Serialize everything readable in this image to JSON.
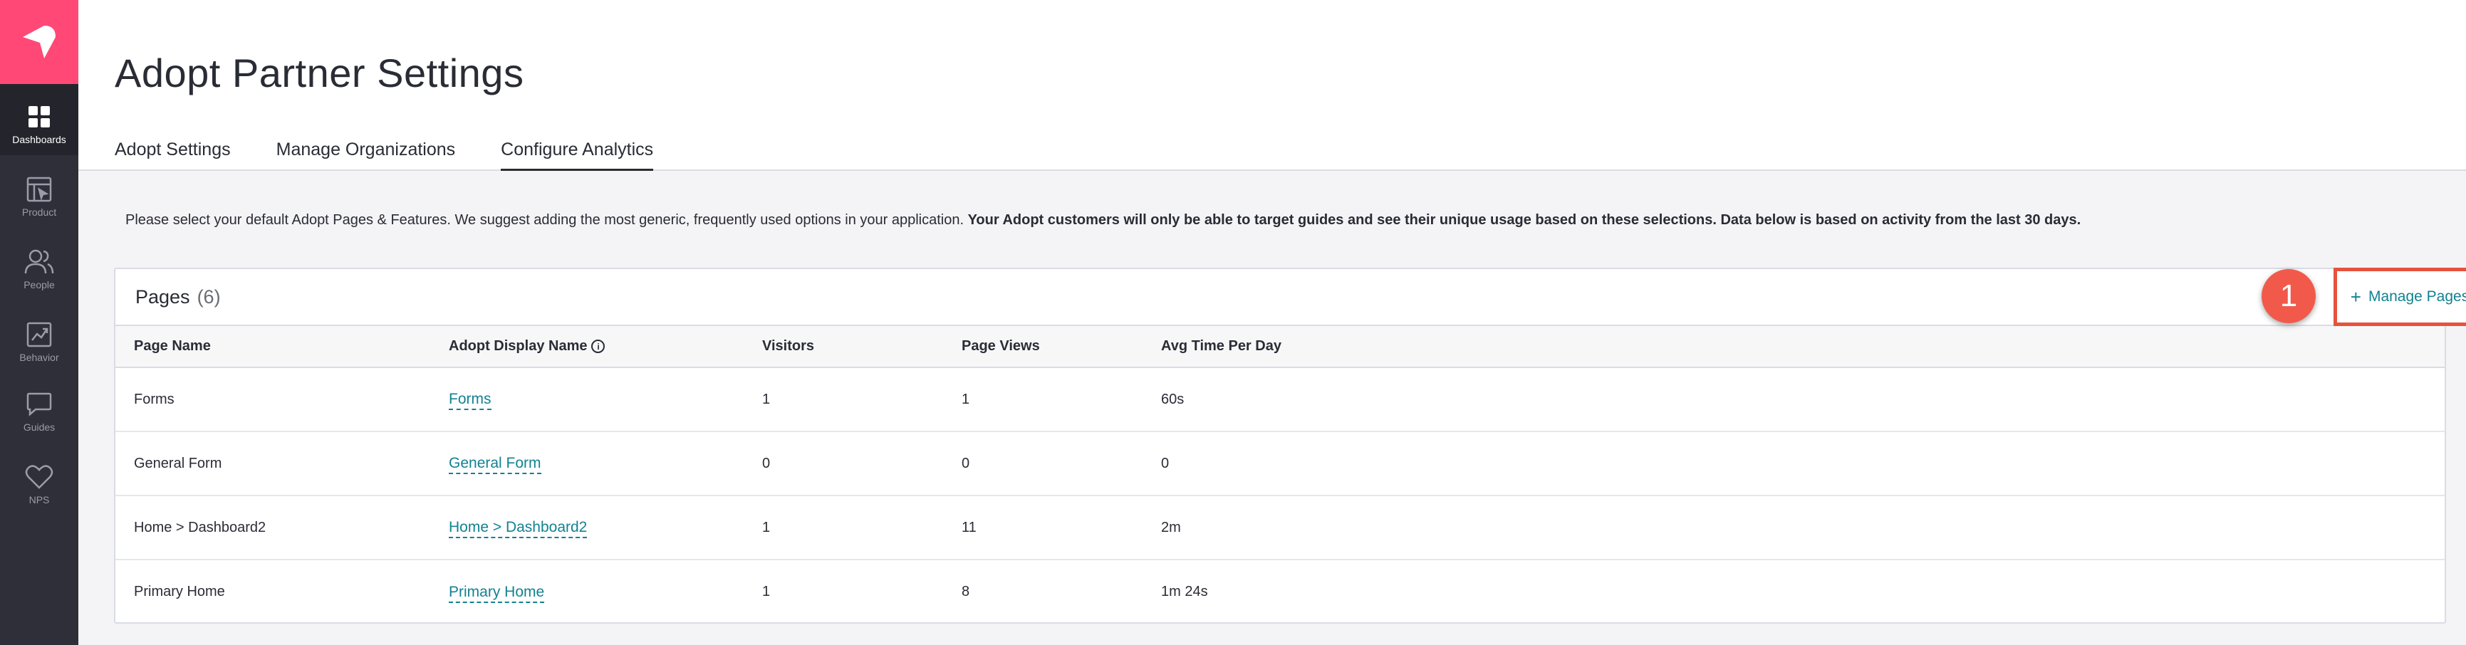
{
  "sidebar": {
    "logo_icon": "pendo-logo-icon",
    "items": [
      {
        "label": "Dashboards",
        "icon": "dashboard-grid-icon",
        "active": true
      },
      {
        "label": "Product",
        "icon": "product-icon",
        "active": false
      },
      {
        "label": "People",
        "icon": "people-icon",
        "active": false
      },
      {
        "label": "Behavior",
        "icon": "behavior-chart-icon",
        "active": false
      },
      {
        "label": "Guides",
        "icon": "guides-chat-icon",
        "active": false
      },
      {
        "label": "NPS",
        "icon": "nps-heart-icon",
        "active": false
      }
    ]
  },
  "header": {
    "title": "Adopt Partner Settings",
    "tabs": [
      {
        "label": "Adopt Settings",
        "active": false
      },
      {
        "label": "Manage Organizations",
        "active": false
      },
      {
        "label": "Configure Analytics",
        "active": true
      }
    ]
  },
  "description": {
    "normal": "Please select your default Adopt Pages & Features. We suggest adding the most generic, frequently used options in your application.",
    "bold": "Your Adopt customers will only be able to target guides and see their unique usage based on these selections. Data below is based on activity from the last 30 days."
  },
  "pages_card": {
    "title": "Pages",
    "count": "(6)",
    "step_number": "1",
    "manage_button_icon": "+",
    "manage_button_label": "Manage Pages",
    "columns": [
      "Page Name",
      "Adopt Display Name",
      "Visitors",
      "Page Views",
      "Avg Time Per Day"
    ],
    "info_icon": "i",
    "rows": [
      {
        "page_name": "Forms",
        "display_name": "Forms",
        "visitors": "1",
        "page_views": "1",
        "avg_time": "60s"
      },
      {
        "page_name": "General Form",
        "display_name": "General Form",
        "visitors": "0",
        "page_views": "0",
        "avg_time": "0"
      },
      {
        "page_name": "Home > Dashboard2",
        "display_name": "Home > Dashboard2",
        "visitors": "1",
        "page_views": "11",
        "avg_time": "2m"
      },
      {
        "page_name": "Primary Home",
        "display_name": "Primary Home",
        "visitors": "1",
        "page_views": "8",
        "avg_time": "1m 24s"
      }
    ]
  },
  "colors": {
    "brand_pink": "#ff4876",
    "sidebar_bg": "#2e2f38",
    "link_teal": "#128292",
    "annotation_red": "#e5533d"
  }
}
